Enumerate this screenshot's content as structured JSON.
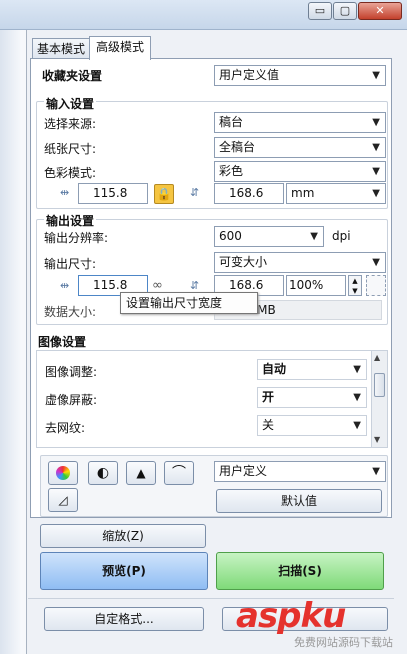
{
  "window": {
    "minimize": "▭",
    "maximize": "▢",
    "close": "✕"
  },
  "tabs": {
    "basic": "基本模式",
    "advanced": "高级模式"
  },
  "favorites": {
    "label": "收藏夹设置",
    "value": "用户定义值"
  },
  "input": {
    "title": "输入设置",
    "source_label": "选择来源:",
    "source_value": "稿台",
    "paper_label": "纸张尺寸:",
    "paper_value": "全稿台",
    "color_label": "色彩模式:",
    "color_value": "彩色",
    "width": "115.8",
    "height": "168.6",
    "unit": "mm"
  },
  "output": {
    "title": "输出设置",
    "resolution_label": "输出分辨率:",
    "resolution_value": "600",
    "resolution_unit": "dpi",
    "size_label": "输出尺寸:",
    "size_value": "可变大小",
    "width": "115.8",
    "height": "168.6",
    "scale": "100%",
    "data_size_label": "数据大小:",
    "data_size_value": "11.18 MB"
  },
  "tooltip": "设置输出尺寸宽度",
  "image": {
    "title": "图像设置",
    "rows": [
      {
        "label": "图像调整:",
        "value": "自动"
      },
      {
        "label": "虚像屏蔽:",
        "value": "开"
      },
      {
        "label": "去网纹:",
        "value": "关"
      }
    ]
  },
  "tools": {
    "preset_value": "用户定义",
    "default_button": "默认值"
  },
  "buttons": {
    "zoom": "缩放(Z)",
    "preview": "预览(P)",
    "scan": "扫描(S)",
    "custom_format": "自定格式..."
  },
  "watermark": {
    "brand": "aspku",
    "sub": "免费网站源码下载站"
  }
}
